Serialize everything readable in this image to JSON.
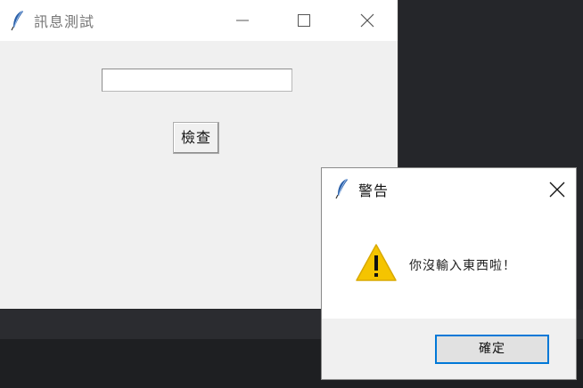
{
  "main_window": {
    "title": "訊息測試",
    "entry_value": "",
    "check_button_label": "檢查"
  },
  "dialog": {
    "title": "警告",
    "message": "你沒輸入東西啦！",
    "ok_button_label": "確定"
  },
  "colors": {
    "accent": "#0078d7",
    "warning": "#f5c400",
    "window_bg": "#f0f0f0",
    "desktop_bg": "#25262a"
  }
}
